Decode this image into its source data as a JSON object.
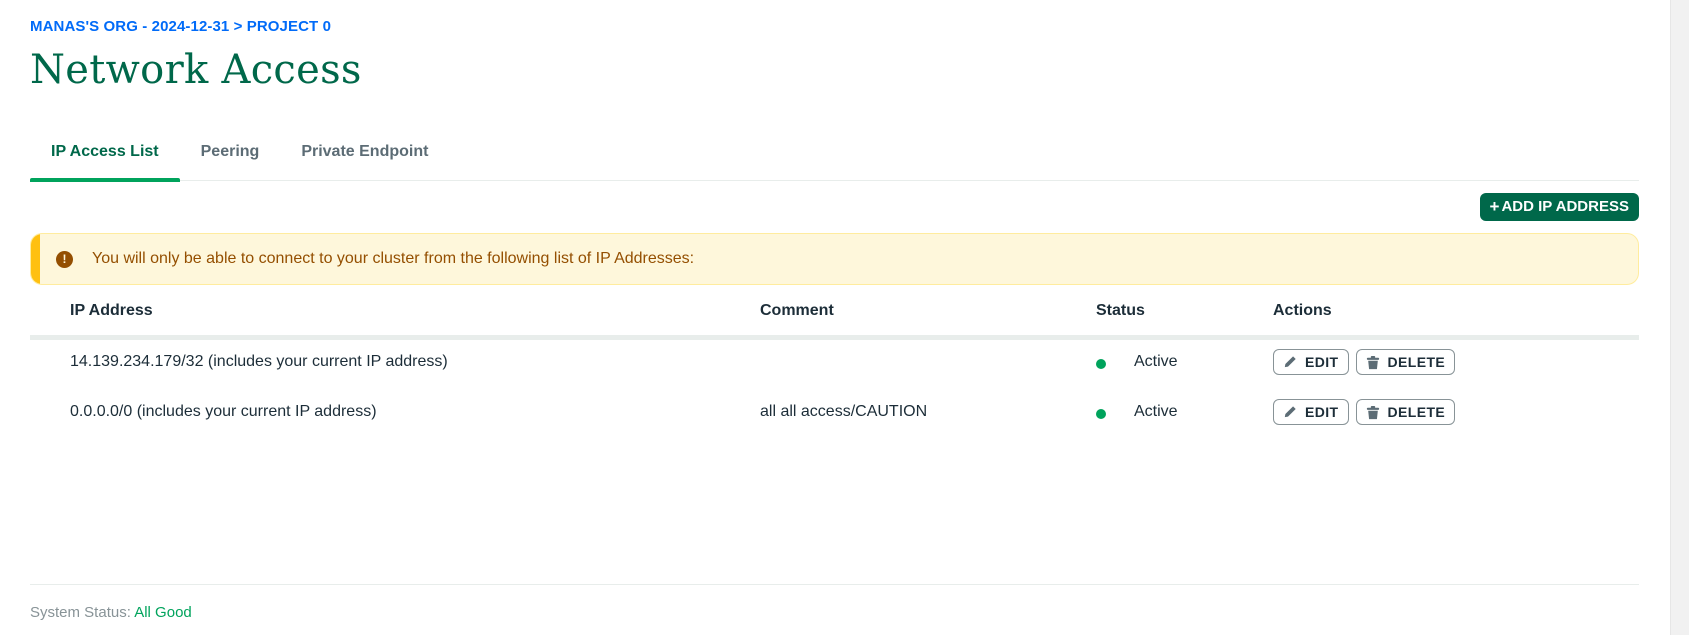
{
  "breadcrumb": "MANAS'S ORG - 2024-12-31 > PROJECT 0",
  "page_title": "Network Access",
  "tabs": [
    {
      "label": "IP Access List",
      "active": true
    },
    {
      "label": "Peering",
      "active": false
    },
    {
      "label": "Private Endpoint",
      "active": false
    }
  ],
  "add_button": {
    "plus": "+",
    "label": "ADD IP ADDRESS"
  },
  "banner": {
    "icon": "exclamation-circle-icon",
    "text": "You will only be able to connect to your cluster from the following list of IP Addresses:"
  },
  "table": {
    "headers": {
      "ip": "IP Address",
      "comment": "Comment",
      "status": "Status",
      "actions": "Actions"
    },
    "rows": [
      {
        "ip": "14.139.234.179/32 (includes your current IP address)",
        "comment": "",
        "status": "Active"
      },
      {
        "ip": "0.0.0.0/0 (includes your current IP address)",
        "comment": "all all access/CAUTION",
        "status": "Active"
      }
    ],
    "edit_label": "EDIT",
    "delete_label": "DELETE"
  },
  "footer": {
    "prefix": "System Status:",
    "status": "All Good"
  },
  "colors": {
    "brand_green": "#00684a",
    "accent_green": "#00a35c",
    "link_blue": "#016bf8",
    "warning_bg": "#fef7db",
    "warning_text": "#944f01"
  }
}
